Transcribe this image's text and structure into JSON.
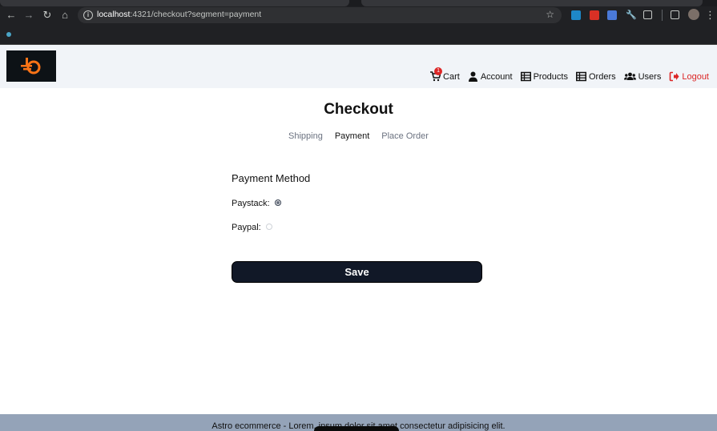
{
  "browser": {
    "url_host": "localhost",
    "url_rest": ":4321/checkout?segment=payment"
  },
  "header": {
    "nav": [
      {
        "label": "Cart",
        "badge": "1"
      },
      {
        "label": "Account"
      },
      {
        "label": "Products"
      },
      {
        "label": "Orders"
      },
      {
        "label": "Users"
      },
      {
        "label": "Logout"
      }
    ]
  },
  "checkout": {
    "title": "Checkout",
    "steps": [
      "Shipping",
      "Payment",
      "Place Order"
    ],
    "active_step": "Payment"
  },
  "payment": {
    "heading": "Payment Method",
    "options": [
      {
        "label": "Paystack:",
        "checked": true
      },
      {
        "label": "Paypal:",
        "checked": false
      }
    ],
    "save_label": "Save"
  },
  "footer": {
    "text": "Astro ecommerce - Lorem, ipsum dolor sit amet consectetur adipisicing elit."
  },
  "colors": {
    "header_bg": "#f1f4f8",
    "button_bg": "#111827",
    "logout": "#dc2626",
    "footer_bg": "#94a3b8",
    "logo_accent": "#f97316"
  }
}
